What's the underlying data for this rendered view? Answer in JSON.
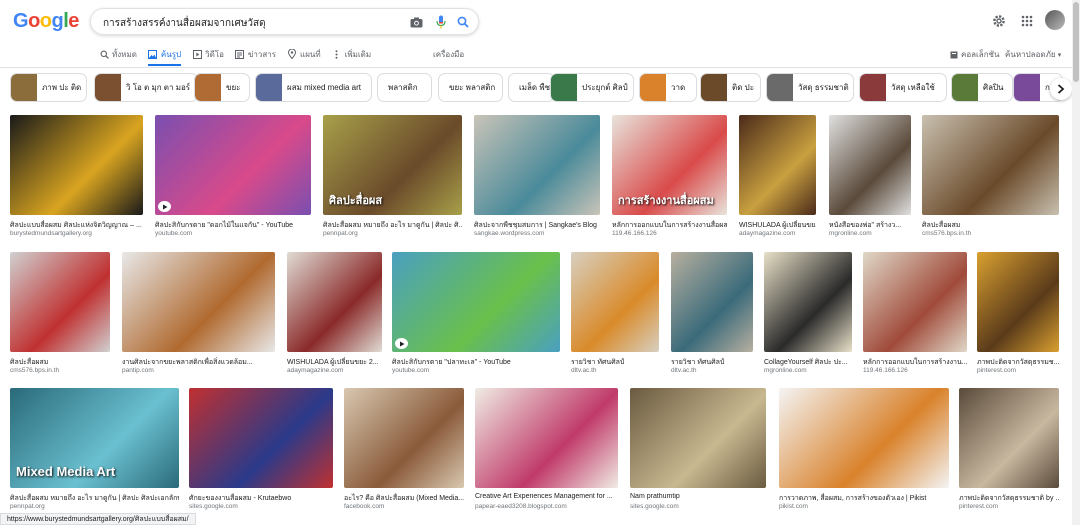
{
  "search": {
    "query": "การสร้างสรรค์งานสื่อผสมจากเศษวัสดุ"
  },
  "logo": {
    "letters": [
      "G",
      "o",
      "o",
      "g",
      "l",
      "e"
    ],
    "colors": [
      "#4285F4",
      "#EA4335",
      "#FBBC05",
      "#4285F4",
      "#34A853",
      "#EA4335"
    ]
  },
  "icons": {
    "camera": "camera-icon",
    "mic": "mic-icon",
    "search": "search-icon",
    "settings": "gear-icon",
    "apps": "apps-grid-icon"
  },
  "tabs": [
    {
      "label": "ทั้งหมด",
      "icon": "search-icon",
      "active": false
    },
    {
      "label": "ค้นรูป",
      "icon": "image-icon",
      "active": true
    },
    {
      "label": "วิดีโอ",
      "icon": "video-icon",
      "active": false
    },
    {
      "label": "ข่าวสาร",
      "icon": "news-icon",
      "active": false
    },
    {
      "label": "แผนที่",
      "icon": "map-pin-icon",
      "active": false
    },
    {
      "label": "เพิ่มเติม",
      "icon": "more-icon",
      "active": false
    }
  ],
  "toolbar": {
    "tools": "เครื่องมือ",
    "collections": "คอลเล็กชัน",
    "safesearch": "ค้นหาปลอดภัย"
  },
  "chips": [
    {
      "label": "ภาพ ปะ ติด",
      "thumb": "#8a6d3b"
    },
    {
      "label": "วิ โอ ต มุก ตา มอร์",
      "thumb": "#7a5030"
    },
    {
      "label": "ขยะ",
      "thumb": "#b06b35"
    },
    {
      "label": "ผสม mixed media art",
      "thumb": "#5a6a9a"
    },
    {
      "label": "พลาสติก",
      "thumb": null
    },
    {
      "label": "ขยะ พลาสติก",
      "thumb": null
    },
    {
      "label": "เมล็ด พืช",
      "thumb": null
    },
    {
      "label": "ประยุกต์ ศิลป์",
      "thumb": "#3a7a4a"
    },
    {
      "label": "วาด",
      "thumb": "#d9822b"
    },
    {
      "label": "ติด ปะ",
      "thumb": "#6b4a2a"
    },
    {
      "label": "วัสดุ ธรรมชาติ",
      "thumb": "#6a6a6a"
    },
    {
      "label": "วัสดุ เหลือใช้",
      "thumb": "#8a3a3a"
    },
    {
      "label": "ศิลปิน",
      "thumb": "#5a7a3a"
    },
    {
      "label": "ก",
      "thumb": "#7a4a9a"
    }
  ],
  "results": [
    {
      "caption": "ศิลปะแบบสื่อผสม ศิลปะแห่งจิตวิญญาณ – ...",
      "source": "burystedmundsartgallery.org",
      "colors": [
        "#1a1a1a",
        "#d9a520"
      ],
      "youtube": false,
      "overlay": ""
    },
    {
      "caption": "ศิลปะสิกับกรตาย \"ดอกไม้ในแจกัน\" - YouTube",
      "source": "youtube.com",
      "colors": [
        "#7a4fb0",
        "#d94a8a"
      ],
      "youtube": true,
      "overlay": ""
    },
    {
      "caption": "ศิลปะสื่อผสม หมายถึง อะไร มาดูกัน | ศิลปะ ศิ...",
      "source": "pennpat.org",
      "colors": [
        "#a8a04a",
        "#6a4a2a"
      ],
      "youtube": false,
      "overlay": "ศิลปะสื่อผส"
    },
    {
      "caption": "ศิลปะจากพืชชุมสมการ | Sangkae's Blog",
      "source": "sangkae.wordpress.com",
      "colors": [
        "#c9c4b8",
        "#4a8a9a"
      ],
      "youtube": false,
      "overlay": ""
    },
    {
      "caption": "หลักการออกแบบในการสร้างงานสื่อผส...",
      "source": "119.46.166.126",
      "colors": [
        "#e8e4dc",
        "#d94a4a"
      ],
      "youtube": false,
      "overlay": "การสร้างงานสื่อผสม"
    },
    {
      "caption": "WISHULADA ผู้เปลี่ยนขย...",
      "source": "adaymagazine.com",
      "colors": [
        "#4a2a1a",
        "#c9a040"
      ],
      "youtube": false,
      "overlay": ""
    },
    {
      "caption": "หนังสือของพ่อ\" สร้างว...",
      "source": "mgronline.com",
      "colors": [
        "#e0e0e0",
        "#5a4a3a"
      ],
      "youtube": false,
      "overlay": ""
    },
    {
      "caption": "ศิลปะสื่อผสม",
      "source": "cms576.bps.in.th",
      "colors": [
        "#c9c0b0",
        "#6a4a2a"
      ],
      "youtube": false,
      "overlay": ""
    },
    {
      "caption": "ศิลปะสื่อผสม",
      "source": "cms576.bps.in.th",
      "colors": [
        "#d0d0d0",
        "#c03030"
      ],
      "youtube": false,
      "overlay": ""
    },
    {
      "caption": "งานศิลปะจากขยะพลาสติกเพื่อสิ่งแวดล้อม...",
      "source": "pantip.com",
      "colors": [
        "#e8e8e8",
        "#b06a30"
      ],
      "youtube": false,
      "overlay": ""
    },
    {
      "caption": "WISHULADA ผู้เปลี่ยนขยะ 2...",
      "source": "adaymagazine.com",
      "colors": [
        "#e0dcd4",
        "#8a2a2a"
      ],
      "youtube": false,
      "overlay": ""
    },
    {
      "caption": "ศิลปะสิกับกรตาย \"ปลาทะเล\" - YouTube",
      "source": "youtube.com",
      "colors": [
        "#4aa0c0",
        "#6ac04a"
      ],
      "youtube": true,
      "overlay": ""
    },
    {
      "caption": "รายวิชา ทัศนศิลป์",
      "source": "dltv.ac.th",
      "colors": [
        "#d8d0c0",
        "#d98a2a"
      ],
      "youtube": false,
      "overlay": ""
    },
    {
      "caption": "รายวิชา ทัศนศิลป์",
      "source": "dltv.ac.th",
      "colors": [
        "#b8b0a0",
        "#3a6a7a"
      ],
      "youtube": false,
      "overlay": ""
    },
    {
      "caption": "CollageYourself ศิลปะ ปะ...",
      "source": "mgronline.com",
      "colors": [
        "#e8e0c8",
        "#2a2a2a"
      ],
      "youtube": false,
      "overlay": ""
    },
    {
      "caption": "หลักการออกแบบในการสร้างงาน...",
      "source": "119.46.166.126",
      "colors": [
        "#e0d8c8",
        "#a04a3a"
      ],
      "youtube": false,
      "overlay": ""
    },
    {
      "caption": "ภาพปะติดจากวัสดุธรรมช...",
      "source": "pinterest.com",
      "colors": [
        "#d9a030",
        "#5a3a1a"
      ],
      "youtube": false,
      "overlay": ""
    },
    {
      "caption": "ศิลปะสื่อผสม หมายถึง อะไร มาดูกัน | ศิลปะ ศิลปะเอกลักษ...",
      "source": "pennpat.org",
      "colors": [
        "#2a6a7a",
        "#6ac0d0"
      ],
      "youtube": false,
      "overlay": "Mixed Media Art"
    },
    {
      "caption": "ศักยะของงานสื่อผสม - Krutaebwo",
      "source": "sites.google.com",
      "colors": [
        "#c03030",
        "#2a3a8a"
      ],
      "youtube": false,
      "overlay": ""
    },
    {
      "caption": "อะไร? คือ ศิลปะสื่อผสม (Mixed Media...",
      "source": "facebook.com",
      "colors": [
        "#d8c8b0",
        "#8a5a3a"
      ],
      "youtube": false,
      "overlay": ""
    },
    {
      "caption": "Creative Art Experiences Management for ...",
      "source": "papear-eaed3208.blogspot.com",
      "colors": [
        "#f0ece4",
        "#c03a6a"
      ],
      "youtube": false,
      "overlay": ""
    },
    {
      "caption": "Nam prathumtip",
      "source": "sites.google.com",
      "colors": [
        "#6a5a40",
        "#c8b890"
      ],
      "youtube": false,
      "overlay": ""
    },
    {
      "caption": "การวาดภาพ, สื่อผสม, การสร้างของตัวเอง | Pikist",
      "source": "pikist.com",
      "colors": [
        "#f4f4f4",
        "#d9822b"
      ],
      "youtube": false,
      "overlay": ""
    },
    {
      "caption": "ภาพปะติดจากวัสดุธรรมชาติ by ...",
      "source": "pinterest.com",
      "colors": [
        "#5a4a3a",
        "#c8b8a0"
      ],
      "youtube": false,
      "overlay": ""
    }
  ],
  "status_url": "https://www.burystedmundsartgallery.org/ศิลปะแบบสื่อผสม/"
}
